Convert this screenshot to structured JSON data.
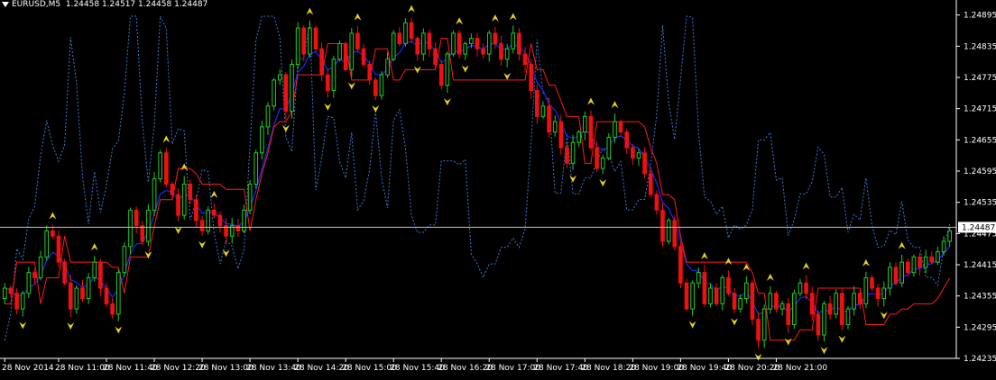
{
  "header": {
    "symbol": "EURUSD,M5",
    "ohlc": "1.24458 1.24517 1.24458 1.24487"
  },
  "colors": {
    "background": "#000000",
    "bull": "#22cc22",
    "bear": "#ee1111",
    "fast_line": "#1a2aff",
    "slow_line": "#ff1a1a",
    "volatility_line": "#3a7ad6",
    "arrow": "#e6d21e",
    "price_line": "#c0c0c0",
    "axis_text": "#ffffff"
  },
  "chart_data": {
    "type": "candlestick",
    "symbol": "EURUSD",
    "timeframe": "M5",
    "ylim": [
      1.24235,
      1.2491
    ],
    "y_ticks": [
      "1.24895",
      "1.24835",
      "1.24775",
      "1.24715",
      "1.24655",
      "1.24595",
      "1.24535",
      "1.24475",
      "1.24415",
      "1.24355",
      "1.24295",
      "1.24235"
    ],
    "current_price": "1.24487",
    "x_ticks": [
      "28 Nov 2014",
      "28 Nov 11:00",
      "28 Nov 11:40",
      "28 Nov 12:20",
      "28 Nov 13:00",
      "28 Nov 13:40",
      "28 Nov 14:20",
      "28 Nov 15:00",
      "28 Nov 15:40",
      "28 Nov 16:20",
      "28 Nov 17:00",
      "28 Nov 17:40",
      "28 Nov 18:20",
      "28 Nov 19:00",
      "28 Nov 19:40",
      "28 Nov 20:20",
      "28 Nov 21:00"
    ],
    "candles_per_tick": 8,
    "grid": false,
    "candles_close": [
      1.2437,
      1.2436,
      1.2433,
      1.2436,
      1.244,
      1.2439,
      1.2443,
      1.2448,
      1.2447,
      1.2442,
      1.2438,
      1.2433,
      1.2437,
      1.2435,
      1.2439,
      1.2442,
      1.2437,
      1.2434,
      1.2432,
      1.244,
      1.2445,
      1.2452,
      1.2449,
      1.2446,
      1.2452,
      1.2458,
      1.2463,
      1.2457,
      1.2455,
      1.2451,
      1.2457,
      1.2454,
      1.245,
      1.2448,
      1.2452,
      1.2451,
      1.2449,
      1.2447,
      1.2449,
      1.2448,
      1.2452,
      1.2457,
      1.2463,
      1.2468,
      1.2472,
      1.2477,
      1.2478,
      1.2471,
      1.248,
      1.2487,
      1.2482,
      1.2487,
      1.2483,
      1.2478,
      1.2475,
      1.2481,
      1.2484,
      1.2479,
      1.2486,
      1.2483,
      1.248,
      1.2477,
      1.2474,
      1.2478,
      1.2481,
      1.2486,
      1.2484,
      1.2488,
      1.2485,
      1.2482,
      1.2486,
      1.2483,
      1.248,
      1.2476,
      1.2482,
      1.2486,
      1.2482,
      1.2484,
      1.2485,
      1.2483,
      1.2482,
      1.2486,
      1.2484,
      1.2481,
      1.2483,
      1.2486,
      1.2482,
      1.248,
      1.2475,
      1.247,
      1.2472,
      1.2467,
      1.2469,
      1.2464,
      1.2461,
      1.2465,
      1.2467,
      1.247,
      1.2464,
      1.246,
      1.2462,
      1.2466,
      1.2469,
      1.2467,
      1.2464,
      1.2462,
      1.2463,
      1.2459,
      1.2455,
      1.2452,
      1.2446,
      1.245,
      1.2445,
      1.2438,
      1.2433,
      1.2438,
      1.244,
      1.2434,
      1.2437,
      1.2434,
      1.2439,
      1.2436,
      1.2433,
      1.2435,
      1.2438,
      1.2431,
      1.2427,
      1.2433,
      1.2436,
      1.2433,
      1.2434,
      1.243,
      1.2436,
      1.2438,
      1.2436,
      1.2432,
      1.2428,
      1.2434,
      1.2432,
      1.2436,
      1.243,
      1.2433,
      1.2436,
      1.2434,
      1.2439,
      1.2437,
      1.2435,
      1.2437,
      1.2441,
      1.2438,
      1.2442,
      1.244,
      1.2443,
      1.2441,
      1.2443,
      1.2442,
      1.2444,
      1.2446,
      1.2448
    ]
  }
}
